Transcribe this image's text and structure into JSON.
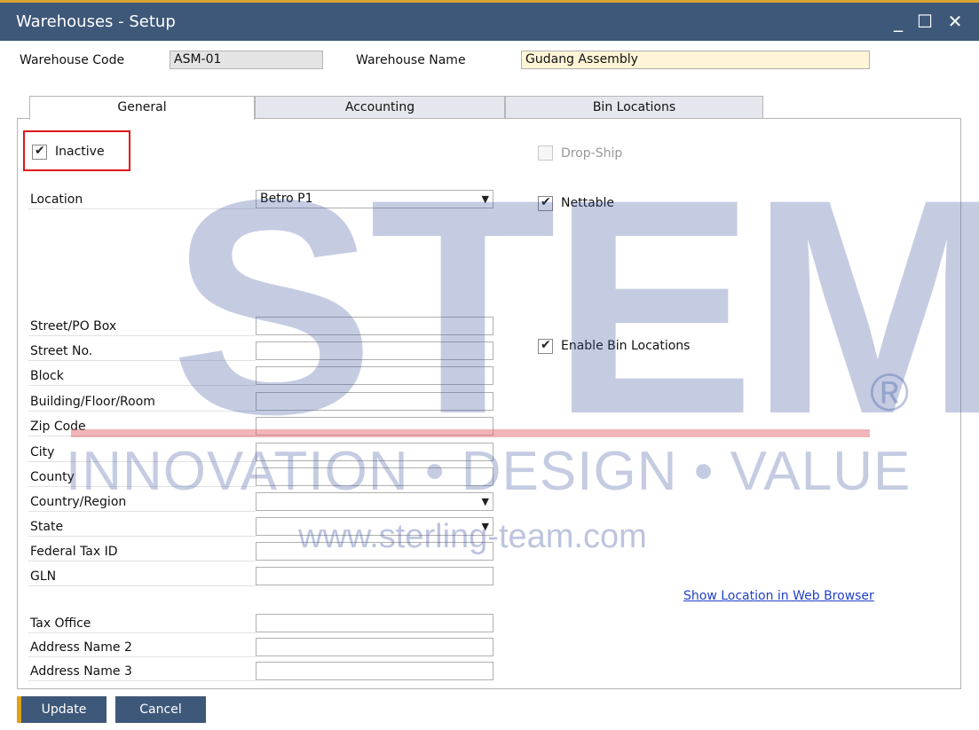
{
  "window": {
    "title": "Warehouses - Setup",
    "controls": {
      "minimize": "_",
      "maximize": "☐",
      "close": "✕"
    }
  },
  "header": {
    "warehouse_code_label": "Warehouse Code",
    "warehouse_code_value": "ASM-01",
    "warehouse_name_label": "Warehouse Name",
    "warehouse_name_value": "Gudang Assembly"
  },
  "tabs": [
    {
      "label": "General",
      "active": true
    },
    {
      "label": "Accounting",
      "active": false
    },
    {
      "label": "Bin Locations",
      "active": false
    }
  ],
  "general": {
    "inactive_label": "Inactive",
    "inactive_checked": true,
    "drop_ship_label": "Drop-Ship",
    "drop_ship_checked": false,
    "nettable_label": "Nettable",
    "nettable_checked": true,
    "enable_bin_label": "Enable Bin Locations",
    "enable_bin_checked": true,
    "location_label": "Location",
    "location_value": "Betro P1",
    "address_fields": [
      {
        "label": "Street/PO Box",
        "value": ""
      },
      {
        "label": "Street No.",
        "value": ""
      },
      {
        "label": "Block",
        "value": ""
      },
      {
        "label": "Building/Floor/Room",
        "value": ""
      },
      {
        "label": "Zip Code",
        "value": ""
      },
      {
        "label": "City",
        "value": ""
      },
      {
        "label": "County",
        "value": ""
      },
      {
        "label": "Country/Region",
        "value": ""
      },
      {
        "label": "State",
        "value": ""
      },
      {
        "label": "Federal Tax ID",
        "value": ""
      },
      {
        "label": "GLN",
        "value": ""
      },
      {
        "label": "Tax Office",
        "value": ""
      },
      {
        "label": "Address Name 2",
        "value": ""
      },
      {
        "label": "Address Name 3",
        "value": ""
      }
    ],
    "web_link": "Show Location in Web Browser"
  },
  "buttons": {
    "update": "Update",
    "cancel": "Cancel"
  },
  "watermark": {
    "logo": "STEM",
    "registered": "®",
    "tagline": "INNOVATION • DESIGN • VALUE",
    "url": "www.sterling-team.com"
  },
  "colors": {
    "titlebar": "#3e5879",
    "accent": "#e0a11b",
    "highlight_box": "#e0161b",
    "link": "#1f3fc8"
  }
}
